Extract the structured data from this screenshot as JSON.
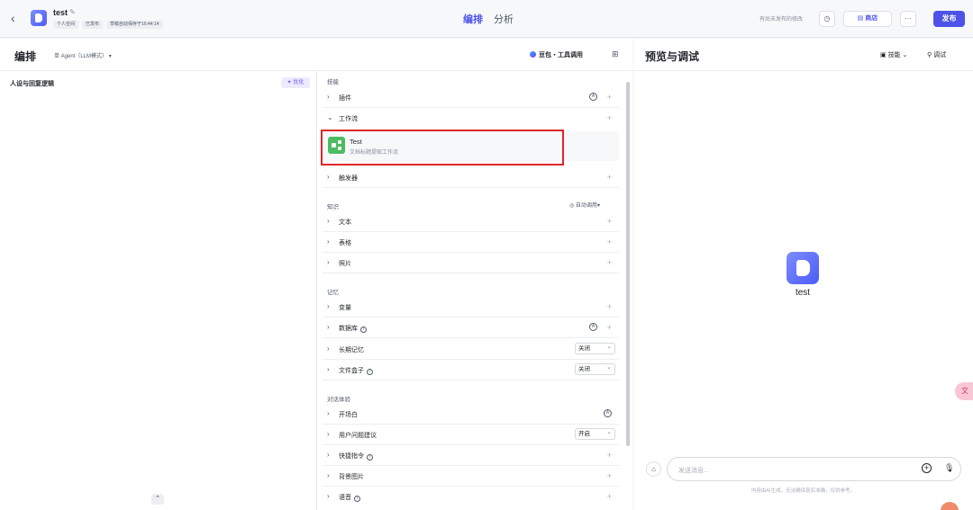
{
  "header": {
    "back_icon": "chevron-left-icon",
    "app_name": "test",
    "badges": [
      "个人空间",
      "已发布",
      "草稿自动保存于16:44:14"
    ],
    "tabs": [
      "编排",
      "分析"
    ],
    "unpublished_note": "有尚未发布的修改",
    "shop_label": "商店",
    "publish_label": "发布"
  },
  "editor": {
    "title": "编排",
    "mode": "单 Agent（LLM模式）",
    "model": "豆包・工具调用",
    "persona_title": "人设与回复逻辑",
    "optimize_label": "优化"
  },
  "skills": {
    "section_skills": "技能",
    "plugin": "插件",
    "workflow": "工作流",
    "workflow_item": {
      "name": "Test",
      "desc": "文档标题提取工作流"
    },
    "trigger": "触发器",
    "section_knowledge": "知识",
    "auto_call": "自动调用",
    "text": "文本",
    "table": "表格",
    "photo": "照片",
    "section_memory": "记忆",
    "variable": "变量",
    "database": "数据库",
    "long_memory": "长期记忆",
    "long_memory_value": "关闭",
    "file_box": "文件盒子",
    "file_box_value": "关闭",
    "section_dialog": "对话体验",
    "opening": "开场白",
    "suggest": "用户问题建议",
    "suggest_value": "开启",
    "shortcut": "快捷指令",
    "background": "背景图片",
    "voice": "语音"
  },
  "preview": {
    "title": "预览与调试",
    "skills_label": "技能",
    "debug_label": "调试",
    "bot_name": "test",
    "input_placeholder": "发送消息...",
    "disclaimer": "内容由AI生成，无法确保真实准确，仅供参考。"
  },
  "colors": {
    "accent": "#4d53e8",
    "workflow_icon": "#4cbc61",
    "highlight_box": "#e0262b"
  }
}
